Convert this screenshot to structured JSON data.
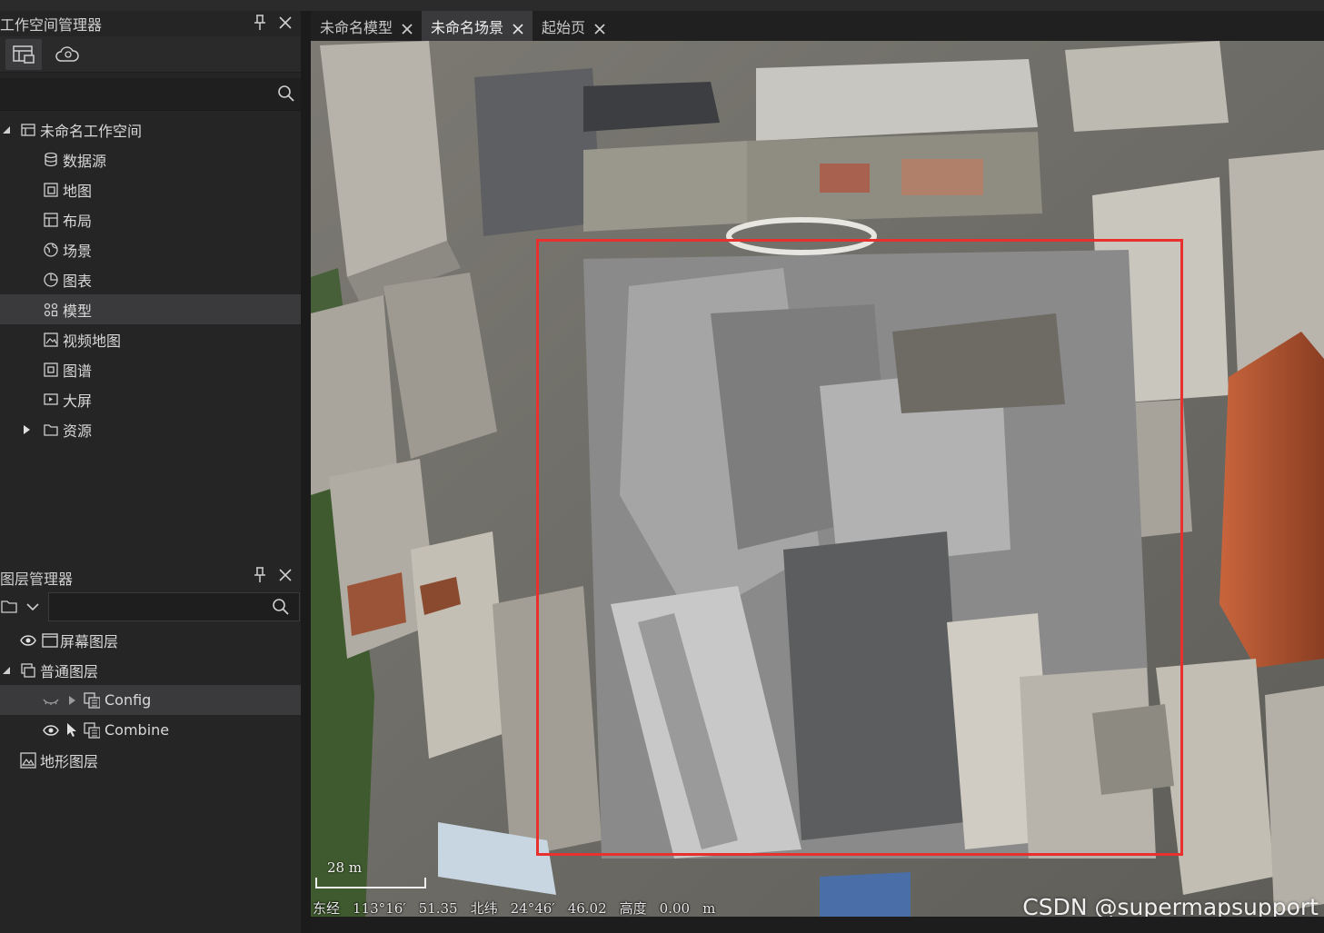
{
  "colors": {
    "panel_bg": "#252526",
    "selected_row": "#3a3a3c",
    "selection_box": "#e8312f",
    "text": "#d8d8d8"
  },
  "workspace_panel": {
    "title": "工作空间管理器",
    "toolbar": [
      {
        "icon": "workspace-icon",
        "active": true
      },
      {
        "icon": "cloud-icon",
        "active": false
      }
    ],
    "search_placeholder": "",
    "tree": [
      {
        "label": "未命名工作空间",
        "icon": "workspace-icon",
        "expanded": true,
        "level": 0
      },
      {
        "label": "数据源",
        "icon": "datasource-icon",
        "level": 1
      },
      {
        "label": "地图",
        "icon": "map-icon",
        "level": 1
      },
      {
        "label": "布局",
        "icon": "layout-icon",
        "level": 1
      },
      {
        "label": "场景",
        "icon": "globe-icon",
        "level": 1
      },
      {
        "label": "图表",
        "icon": "chart-icon",
        "level": 1
      },
      {
        "label": "模型",
        "icon": "model-icon",
        "level": 1,
        "selected": true
      },
      {
        "label": "视频地图",
        "icon": "video-map-icon",
        "level": 1
      },
      {
        "label": "图谱",
        "icon": "graph-icon",
        "level": 1
      },
      {
        "label": "大屏",
        "icon": "dashboard-icon",
        "level": 1
      },
      {
        "label": "资源",
        "icon": "folder-icon",
        "level": 1,
        "collapsed": true
      }
    ]
  },
  "layer_panel": {
    "title": "图层管理器",
    "search_placeholder": "",
    "tree": [
      {
        "label": "屏幕图层",
        "icon": "screen-layer-icon",
        "visible": true,
        "level": 0
      },
      {
        "label": "普通图层",
        "icon": "layers-icon",
        "expanded": true,
        "level": 0
      },
      {
        "label": "Config",
        "icon": "model-layer-icon",
        "visible": false,
        "level": 1,
        "selected": true
      },
      {
        "label": "Combine",
        "icon": "model-layer-icon",
        "visible": true,
        "level": 1
      },
      {
        "label": "地形图层",
        "icon": "terrain-icon",
        "level": 0
      }
    ]
  },
  "tabs": [
    {
      "label": "未命名模型",
      "active": false
    },
    {
      "label": "未命名场景",
      "active": true
    },
    {
      "label": "起始页",
      "active": false
    }
  ],
  "scene": {
    "scale_label": "28 m",
    "status": {
      "lon_label": "东经",
      "lon_value": "113°16′",
      "lon_sec": "51.35",
      "lat_label": "北纬",
      "lat_value": "24°46′",
      "lat_sec": "46.02",
      "alt_label": "高度",
      "alt_value": "0.00",
      "alt_unit": "m"
    },
    "watermark": "CSDN @supermapsupport"
  }
}
